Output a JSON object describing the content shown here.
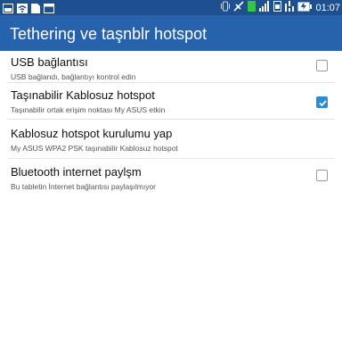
{
  "status_bar": {
    "time": "01:07",
    "left_icons": [
      "photo-icon",
      "wifi-icon",
      "document-icon",
      "window-icon"
    ],
    "right_icons": [
      "vibrate-icon",
      "nfc-icon",
      "data-icon",
      "signal-icon",
      "sim-icon",
      "wifi-signal-icon",
      "battery-icon"
    ]
  },
  "header": {
    "title": "Tethering ve taşnblr hotspot"
  },
  "items": [
    {
      "title": "USB bağlantısı",
      "subtitle": "USB bağlandı, bağlantıyı kontrol edin",
      "checkbox": false
    },
    {
      "title": "Taşınabilir Kablosuz hotspot",
      "subtitle": "Taşınabilir ortak erişim noktası My ASUS etkin",
      "checkbox": true
    },
    {
      "title": "Kablosuz hotspot kurulumu yap",
      "subtitle": "My ASUS WPA2 PSK taşınabilir Kablosuz hotspot"
    },
    {
      "title": "Bluetooth internet paylşm",
      "subtitle": "Bu tabletin İnternet bağlantısı paylaşılmıyor",
      "checkbox": false
    }
  ],
  "colors": {
    "status_bar": "#1e4f8e",
    "action_bar": "#2763ad",
    "accent": "#2f8ad4"
  }
}
